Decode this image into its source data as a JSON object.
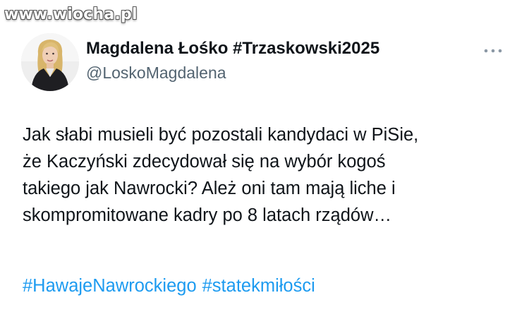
{
  "watermark": "www.wiocha.pl",
  "author": {
    "display_name": "Magdalena Łośko #Trzaskowski2025",
    "handle": "@LoskoMagdalena",
    "avatar_icon": "profile-photo"
  },
  "more_icon": "more-horizontal-icon",
  "tweet": {
    "lines": [
      "Jak słabi musieli być pozostali kandydaci w PiSie,",
      "że Kaczyński zdecydował się na wybór kogoś",
      "takiego jak Nawrocki? Ależ oni tam mają liche i",
      "skompromitowane kadry po 8 latach rządów…"
    ],
    "hashtags": [
      "#HawajeNawrockiego",
      "#statekmiłości"
    ]
  },
  "colors": {
    "text": "#0f1419",
    "secondary": "#536471",
    "link": "#1d9bf0"
  }
}
